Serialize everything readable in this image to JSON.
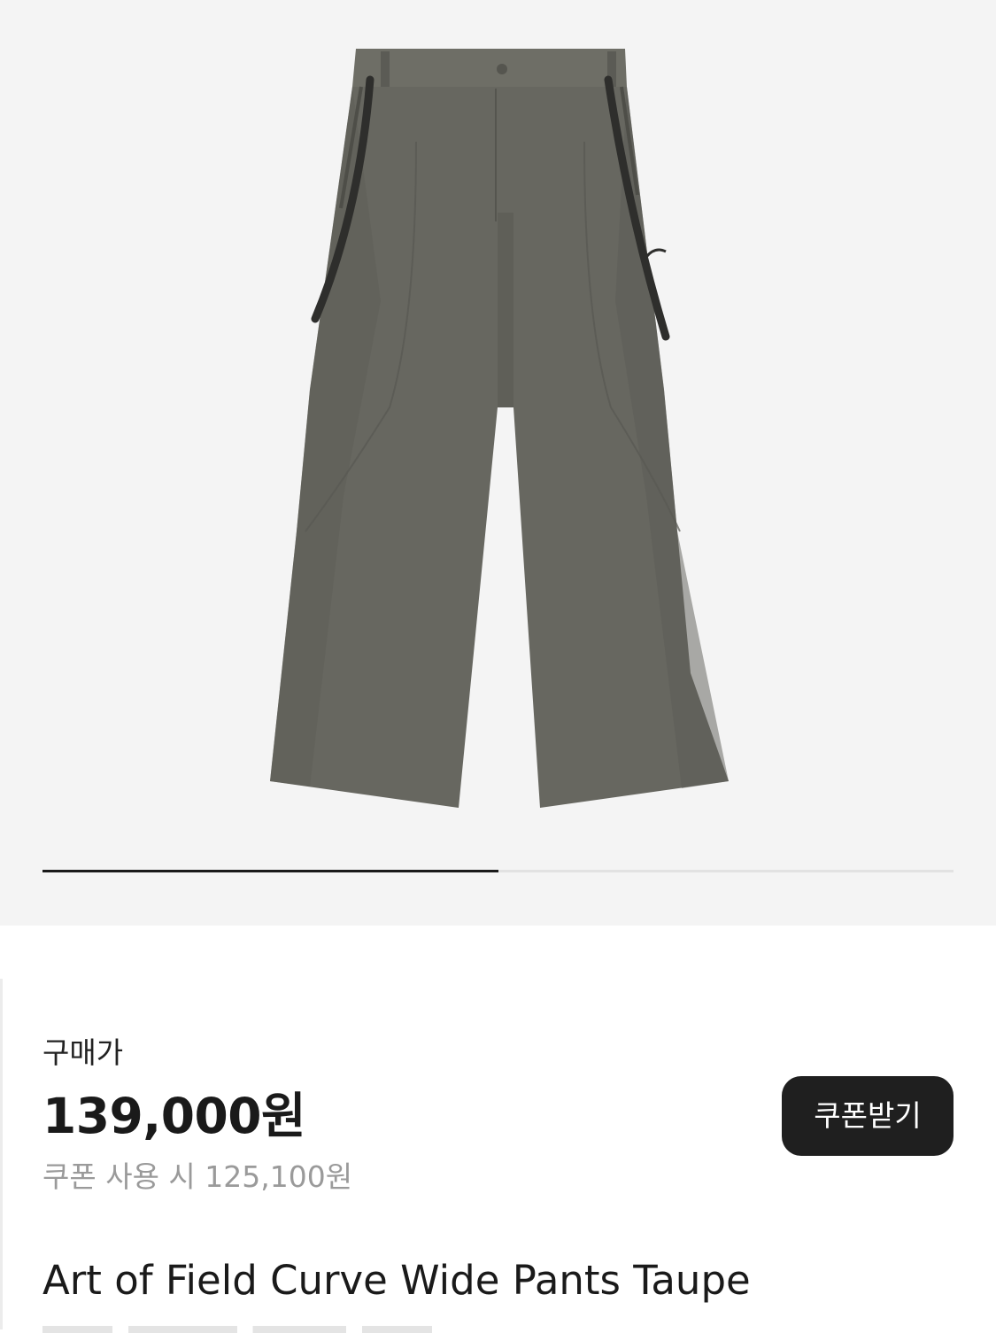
{
  "gallery": {
    "current_index": 1,
    "total_images": 2,
    "background_color": "#f4f4f4",
    "product_color": "#6b6b62"
  },
  "pricing": {
    "label": "구매가",
    "price": "139,000원",
    "coupon_price_text": "쿠폰 사용 시 125,100원"
  },
  "actions": {
    "coupon_button_label": "쿠폰받기"
  },
  "product": {
    "title": "Art of Field Curve Wide Pants Taupe"
  }
}
